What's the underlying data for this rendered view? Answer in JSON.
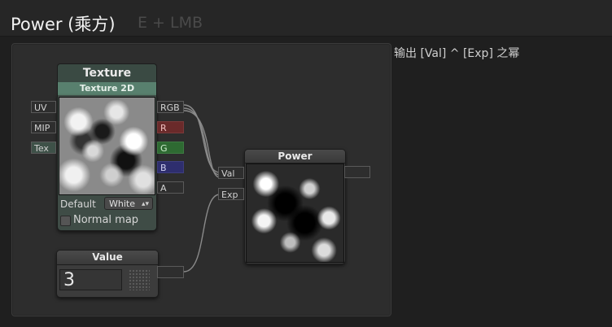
{
  "header": {
    "title": "Power (乘方)",
    "shortcut": "E + LMB"
  },
  "description": "输出 [Val] ^ [Exp] 之幂",
  "texture_node": {
    "title": "Texture",
    "subtitle": "Texture 2D",
    "inputs": [
      "UV",
      "MIP",
      "Tex"
    ],
    "outputs": [
      "RGB",
      "R",
      "G",
      "B",
      "A"
    ],
    "default_label": "Default",
    "default_value": "White",
    "normal_map_label": "Normal map"
  },
  "power_node": {
    "title": "Power",
    "inputs": [
      "Val",
      "Exp"
    ]
  },
  "value_node": {
    "title": "Value",
    "value": "3"
  },
  "colors": {
    "texture_accent": "#58806e",
    "r_channel": "#6a2a2a",
    "g_channel": "#2e6a32",
    "b_channel": "#2e2e6e",
    "wire": "#8a8a8a"
  }
}
